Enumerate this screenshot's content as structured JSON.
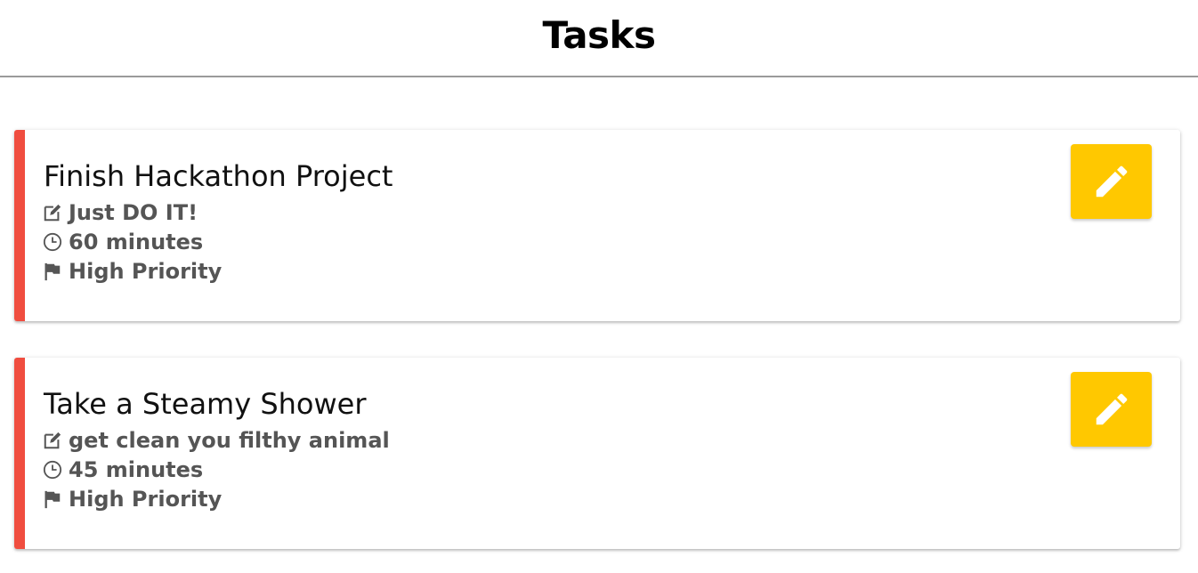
{
  "header": {
    "title": "Tasks"
  },
  "colors": {
    "priority_stripe": "#f04d3f",
    "edit_button": "#ffc800",
    "meta_text": "#555555",
    "divider": "#9a9a9a"
  },
  "icons": {
    "description": "edit-note-icon",
    "duration": "clock-icon",
    "priority": "flag-icon",
    "edit": "pencil-icon"
  },
  "tasks": [
    {
      "title": "Finish Hackathon Project",
      "description": "Just DO IT!",
      "duration": "60 minutes",
      "priority": "High Priority"
    },
    {
      "title": "Take a Steamy Shower",
      "description": "get clean you filthy animal",
      "duration": "45 minutes",
      "priority": "High Priority"
    }
  ]
}
